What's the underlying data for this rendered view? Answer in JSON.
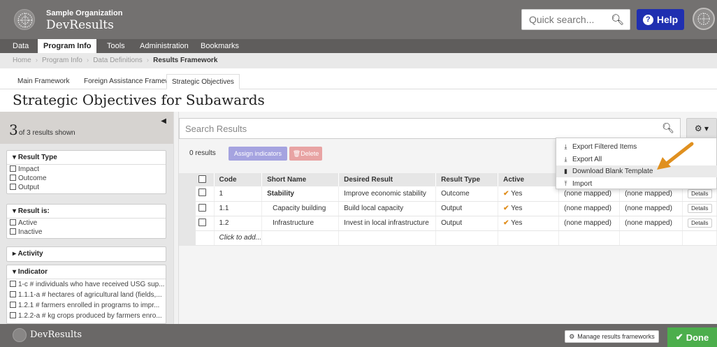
{
  "header": {
    "org_name": "Sample Organization",
    "app_name": "DevResults",
    "search_placeholder": "Quick search...",
    "help_label": "Help"
  },
  "nav": {
    "tabs": [
      {
        "label": "Data"
      },
      {
        "label": "Program Info"
      },
      {
        "label": "Tools"
      },
      {
        "label": "Administration"
      },
      {
        "label": "Bookmarks"
      }
    ]
  },
  "breadcrumb": [
    "Home",
    "Program Info",
    "Data Definitions",
    "Results Framework"
  ],
  "subtabs": [
    "Main Framework",
    "Foreign Assistance Framework",
    "Strategic Objectives"
  ],
  "page_title": "Strategic Objectives for Subawards",
  "left_panel": {
    "count": "3",
    "count_text": "of 3 results shown",
    "filters": [
      {
        "title": "Result Type",
        "items": [
          "Impact",
          "Outcome",
          "Output"
        ]
      },
      {
        "title": "Result is:",
        "items": [
          "Active",
          "Inactive"
        ]
      },
      {
        "title": "Activity",
        "items": []
      },
      {
        "title": "Indicator",
        "items": [
          "1-c # individuals who have received USG sup...",
          "1.1.1-a # hectares of agricultural land (fields,...",
          "1.2.1 # farmers enrolled in programs to impr...",
          "1.2.2-a # kg crops produced by farmers enro..."
        ]
      }
    ]
  },
  "right_panel": {
    "search_placeholder": "Search Results",
    "results_label": "0 results",
    "assign_label": "Assign indicators",
    "delete_label": "Delete",
    "columns": [
      "Code",
      "Short Name",
      "Desired Result",
      "Result Type",
      "Active"
    ],
    "rows": [
      {
        "code": "1",
        "short_name": "Stability",
        "desired": "Improve economic stability",
        "type": "Outcome",
        "active": "Yes",
        "m1": "(none mapped)",
        "m2": "(none mapped)",
        "details": "Details"
      },
      {
        "code": "1.1",
        "short_name": "Capacity building",
        "desired": "Build local capacity",
        "type": "Output",
        "active": "Yes",
        "m1": "(none mapped)",
        "m2": "(none mapped)",
        "details": "Details"
      },
      {
        "code": "1.2",
        "short_name": "Infrastructure",
        "desired": "Invest in local infrastructure",
        "type": "Output",
        "active": "Yes",
        "m1": "(none mapped)",
        "m2": "(none mapped)",
        "details": "Details"
      }
    ],
    "add_row_label": "Click to add..."
  },
  "dropdown": {
    "items": [
      {
        "label": "Export Filtered Items",
        "icon": "download-icon"
      },
      {
        "label": "Export All",
        "icon": "download-icon"
      },
      {
        "label": "Download Blank Template",
        "icon": "file-icon"
      },
      {
        "label": "Import",
        "icon": "upload-icon"
      }
    ]
  },
  "footer": {
    "app_name": "DevResults",
    "manage_label": "Manage results frameworks",
    "done_label": "Done"
  },
  "colors": {
    "header_bg": "#737170",
    "help_blue": "#1f2fb0",
    "done_green": "#4cae4c",
    "check_orange": "#e08f1f",
    "arrow_orange": "#e0901f"
  }
}
